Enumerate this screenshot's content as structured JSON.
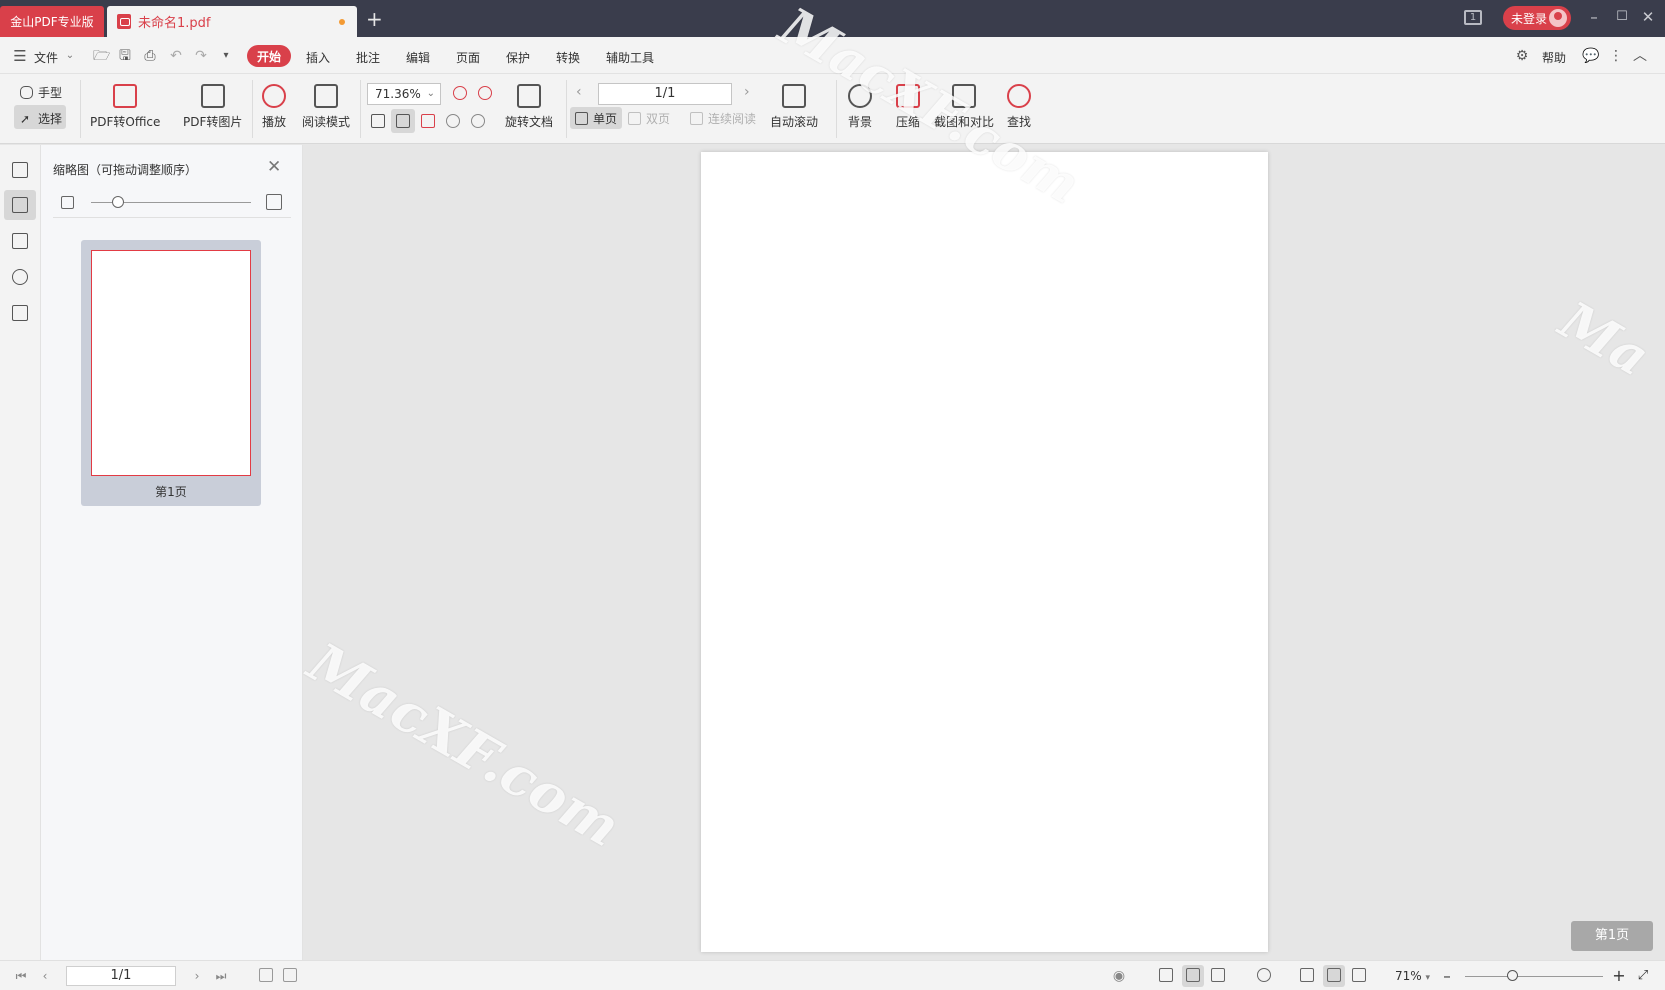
{
  "titlebar": {
    "app_tab": "金山PDF专业版",
    "doc_tab": "未命名1.pdf",
    "new_tab": "+",
    "badge": "1",
    "login": "未登录",
    "minimize": "–",
    "maximize": "☐",
    "close": "✕"
  },
  "menu": {
    "file": "文件",
    "items": [
      "开始",
      "插入",
      "批注",
      "编辑",
      "页面",
      "保护",
      "转换",
      "辅助工具"
    ],
    "help": "帮助"
  },
  "ribbon": {
    "hand": "手型",
    "select": "选择",
    "pdf_to_office": "PDF转Office",
    "pdf_to_image": "PDF转图片",
    "play": "播放",
    "read_mode": "阅读模式",
    "zoom_value": "71.36%",
    "rotate_doc": "旋转文档",
    "page_value": "1/1",
    "single_page": "单页",
    "double_page": "双页",
    "continuous": "连续阅读",
    "auto_scroll": "自动滚动",
    "background": "背景",
    "compress": "压缩",
    "screenshot_compare": "截图和对比",
    "find": "查找"
  },
  "thumbnail_panel": {
    "title": "缩略图（可拖动调整顺序）",
    "thumb_label": "第1页"
  },
  "canvas": {
    "page_badge": "第1页"
  },
  "watermarks": [
    "MacXF.com",
    "MacXF.com",
    "Ma"
  ],
  "statusbar": {
    "page_value": "1/1",
    "zoom": "71%"
  },
  "colors": {
    "accent": "#d9404a",
    "titlebar": "#3a3d4c"
  }
}
